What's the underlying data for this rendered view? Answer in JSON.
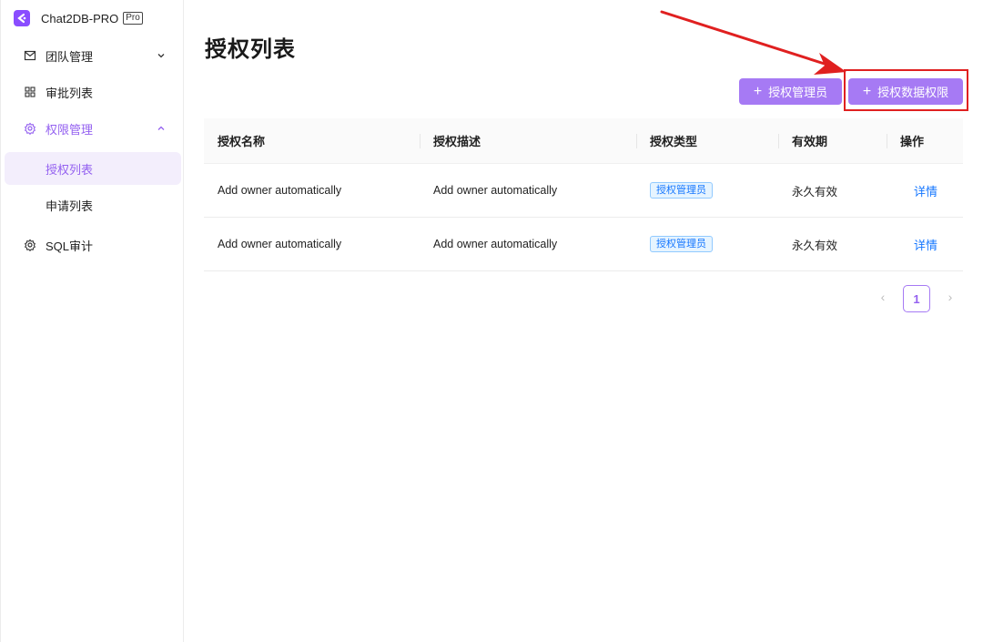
{
  "app": {
    "name": "Chat2DB-PRO",
    "badge": "Pro"
  },
  "sidebar": {
    "items": [
      {
        "label": "团队管理",
        "icon": "mail-icon",
        "arrow": "chevron-down-icon"
      },
      {
        "label": "审批列表",
        "icon": "grid-icon"
      },
      {
        "label": "权限管理",
        "icon": "gear-icon",
        "arrow": "chevron-up-icon"
      },
      {
        "label": "授权列表"
      },
      {
        "label": "申请列表"
      },
      {
        "label": "SQL审计",
        "icon": "gear-icon"
      }
    ]
  },
  "page": {
    "title": "授权列表"
  },
  "toolbar": {
    "add_admin_label": "授权管理员",
    "add_data_perm_label": "授权数据权限"
  },
  "table": {
    "columns": [
      "授权名称",
      "授权描述",
      "授权类型",
      "有效期",
      "操作"
    ],
    "rows": [
      {
        "name": "Add owner automatically",
        "desc": "Add owner automatically",
        "type": "授权管理员",
        "validity": "永久有效",
        "action": "详情"
      },
      {
        "name": "Add owner automatically",
        "desc": "Add owner automatically",
        "type": "授权管理员",
        "validity": "永久有效",
        "action": "详情"
      }
    ]
  },
  "pagination": {
    "prev": "‹",
    "current": "1",
    "next": "›"
  },
  "colors": {
    "accent": "#a67af4",
    "accent_text": "#9461f0",
    "link": "#1677ff",
    "annotation": "#e02020"
  }
}
